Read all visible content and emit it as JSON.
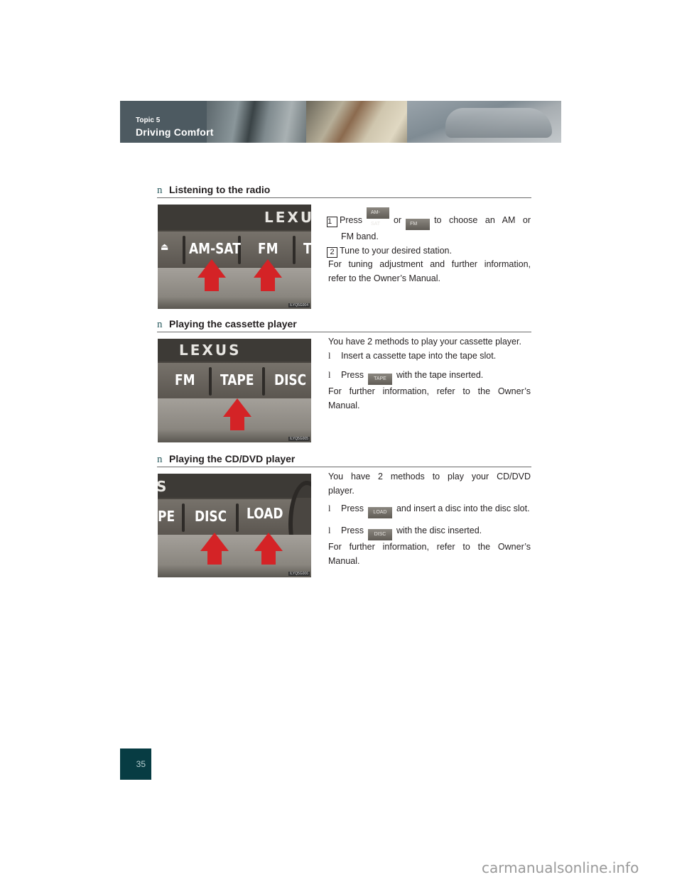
{
  "header": {
    "topic": "Topic 5",
    "title": "Driving Comfort"
  },
  "sections": [
    {
      "heading": "Listening to the radio",
      "bullet": "n",
      "image": {
        "brand": "LEXU",
        "buttons": [
          "AM-SAT",
          "FM",
          "T"
        ],
        "code": "ILYQ5G004"
      },
      "steps": [
        {
          "num": "1",
          "pre": "Press",
          "chip1": "AM-SAT",
          "mid": "or",
          "chip2": "FM",
          "post": "to choose an AM or",
          "cont": "FM band."
        },
        {
          "num": "2",
          "text": "Tune to your desired station."
        }
      ],
      "note_line1": "For tuning adjustment and further information,",
      "note_line2": "refer to the Owner’s Manual."
    },
    {
      "heading": "Playing the cassette player",
      "bullet": "n",
      "image": {
        "brand": "LEXUS",
        "buttons": [
          "FM",
          "TAPE",
          "DISC"
        ],
        "code": "ILYQ5G005"
      },
      "intro": "You have 2 methods to play your cassette player.",
      "methods": [
        {
          "bullet": "l",
          "text": "Insert a cassette tape into the tape slot."
        },
        {
          "bullet": "l",
          "pre": "Press",
          "chip": "TAPE",
          "post": "with the tape inserted."
        }
      ],
      "note_line1": "For further information, refer to the Owner’s",
      "note_line2": "Manual."
    },
    {
      "heading": "Playing the CD/DVD player",
      "bullet": "n",
      "image": {
        "brand": "S",
        "buttons": [
          "PE",
          "DISC",
          "LOAD"
        ],
        "code": "ILYQ5G006"
      },
      "intro_line1": "You have 2 methods to play your CD/DVD",
      "intro_line2": "player.",
      "methods": [
        {
          "bullet": "l",
          "pre": "Press",
          "chip": "LOAD",
          "post": "and insert a disc into the disc slot."
        },
        {
          "bullet": "l",
          "pre": "Press",
          "chip": "DISC",
          "post": "with the disc inserted."
        }
      ],
      "note_line1": "For further information, refer to the Owner’s",
      "note_line2": "Manual."
    }
  ],
  "page_number": "35",
  "watermark": "carmanualsonline.info",
  "colors": {
    "banner": "#4d5a61",
    "page_number_bg": "#073c43",
    "bullet": "#2a5b5f",
    "arrow": "#d42326"
  }
}
